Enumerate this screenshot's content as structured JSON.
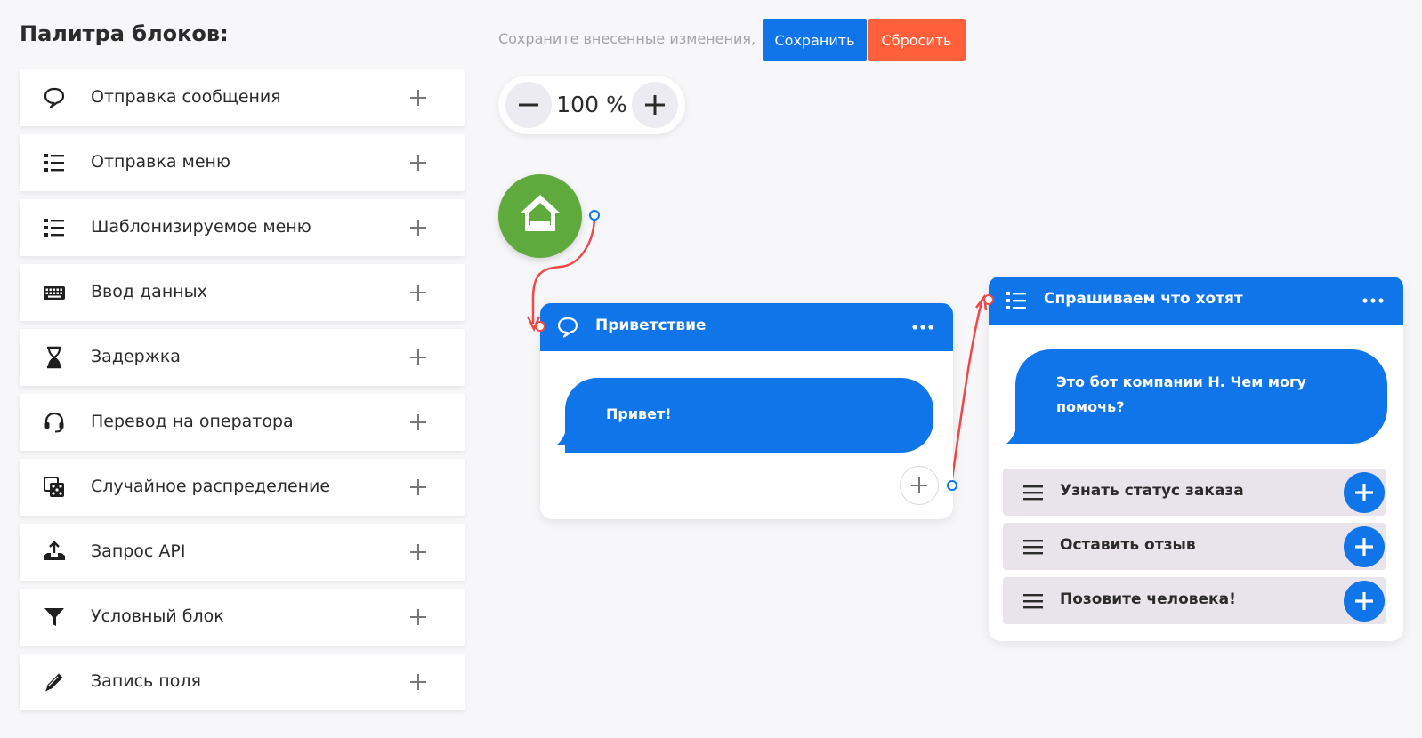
{
  "palette": {
    "title": "Палитра блоков:",
    "items": [
      {
        "label": "Отправка сообщения",
        "icon": "speech-bubble-icon"
      },
      {
        "label": "Отправка меню",
        "icon": "list-icon"
      },
      {
        "label": "Шаблонизируемое меню",
        "icon": "list-icon"
      },
      {
        "label": "Ввод данных",
        "icon": "keyboard-icon"
      },
      {
        "label": "Задержка",
        "icon": "hourglass-icon"
      },
      {
        "label": "Перевод на оператора",
        "icon": "headset-icon"
      },
      {
        "label": "Случайное распределение",
        "icon": "dice-icon"
      },
      {
        "label": "Запрос API",
        "icon": "api-upload-icon"
      },
      {
        "label": "Условный блок",
        "icon": "funnel-icon"
      },
      {
        "label": "Запись поля",
        "icon": "pencil-icon"
      }
    ]
  },
  "toolbar": {
    "save_hint": "Сохраните внесенные изменения,",
    "save_label": "Сохранить",
    "reset_label": "Сбросить"
  },
  "zoom": {
    "value": "100 %"
  },
  "colors": {
    "accent": "#1075e8",
    "reset": "#ff5f3a",
    "start": "#5eaa3c",
    "connector": "#f04848",
    "menu_row": "#e9e3ec"
  },
  "canvas": {
    "greeting_node": {
      "title": "Приветствие",
      "icon": "speech-bubble-icon",
      "message": "Привет!"
    },
    "menu_node": {
      "title": "Спрашиваем что хотят",
      "icon": "list-icon",
      "message_line1": "Это бот компании Н. Чем могу",
      "message_line2": "помочь?",
      "options": [
        {
          "label": "Узнать статус заказа"
        },
        {
          "label": "Оставить отзыв"
        },
        {
          "label": "Позовите человека!"
        }
      ]
    }
  }
}
